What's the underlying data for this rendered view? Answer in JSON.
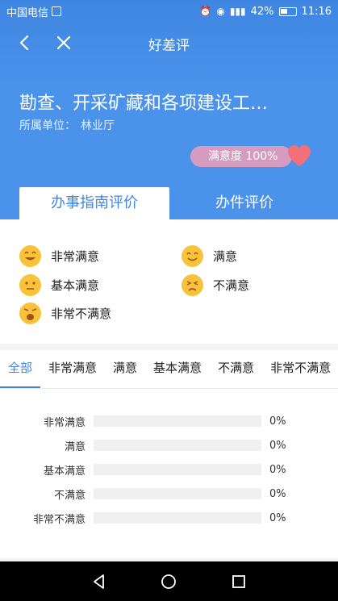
{
  "status_bar": {
    "carrier": "中国电信",
    "battery": "42%",
    "time": "11:16"
  },
  "nav": {
    "title": "好差评"
  },
  "header": {
    "title": "勘查、开采矿藏和各项建设工…",
    "unit_label": "所属单位：",
    "unit_value": "林业厅",
    "satisfaction": "满意度 100%"
  },
  "tabs": [
    {
      "label": "办事指南评价",
      "active": true
    },
    {
      "label": "办件评价",
      "active": false
    }
  ],
  "legend": [
    {
      "label": "非常满意",
      "face": "very-satisfied"
    },
    {
      "label": "满意",
      "face": "satisfied"
    },
    {
      "label": "基本满意",
      "face": "neutral"
    },
    {
      "label": "不满意",
      "face": "dissatisfied"
    },
    {
      "label": "非常不满意",
      "face": "very-dissatisfied"
    }
  ],
  "filters": [
    "全部",
    "非常满意",
    "满意",
    "基本满意",
    "不满意",
    "非常不满意"
  ],
  "ratings": [
    {
      "label": "非常满意",
      "percent": "0%",
      "value": 0
    },
    {
      "label": "满意",
      "percent": "0%",
      "value": 0
    },
    {
      "label": "基本满意",
      "percent": "0%",
      "value": 0
    },
    {
      "label": "不满意",
      "percent": "0%",
      "value": 0
    },
    {
      "label": "非常不满意",
      "percent": "0%",
      "value": 0
    }
  ],
  "colors": {
    "primary": "#3f86e2",
    "badge": "#d59cc0",
    "heart": "#f36f7a",
    "face": "#f8c33a"
  }
}
